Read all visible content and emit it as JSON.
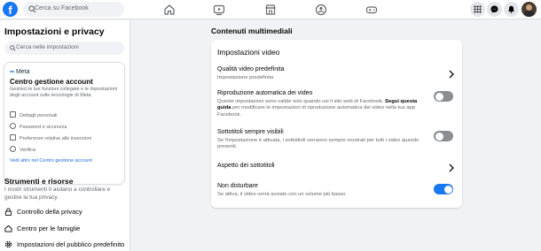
{
  "topbar": {
    "logo_letter": "f",
    "search_placeholder": "Cerca su Facebook",
    "nav_icons": [
      "home-icon",
      "video-icon",
      "marketplace-icon",
      "groups-icon",
      "gaming-icon"
    ],
    "right_icons": [
      "menu-grid-icon",
      "messenger-icon",
      "notifications-icon"
    ]
  },
  "sidebar": {
    "title": "Impostazioni e privacy",
    "search_placeholder": "Cerca nelle impostazioni",
    "account_center": {
      "brand": "Meta",
      "title": "Centro gestione account",
      "description": "Gestisci le tue funzioni collegate e le impostazioni degli account sulle tecnologie di Meta.",
      "items": [
        "Dettagli personali",
        "Password e sicurezza",
        "Preferenze relative alle inserzioni",
        "Verifica"
      ],
      "link": "Vedi altro nel Centro gestione account"
    },
    "tools": {
      "title": "Strumenti e risorse",
      "description": "I nostri strumenti ti aiutano a controllare e gestire la tua privacy.",
      "items": [
        "Controllo della privacy",
        "Centro per le famiglie",
        "Impostazioni del pubblico predefinito"
      ]
    }
  },
  "main": {
    "section_title": "Contenuti multimediali",
    "card_title": "Impostazioni video",
    "rows": [
      {
        "label": "Qualità video predefinita",
        "sub": "Impostazione predefinita",
        "control": "chevron"
      },
      {
        "label": "Riproduzione automatica dei video",
        "sub_pre": "Queste impostazioni sono valide solo quando usi il sito web di Facebook. ",
        "sub_bold": "Segui questa guida",
        "sub_post": " per modificare le impostazioni di riproduzione automatica dei video nella tua app Facebook.",
        "control": "toggle",
        "checked": false
      },
      {
        "label": "Sottotitoli sempre visibili",
        "sub": "Se l'impostazione è attivata, i sottotitoli verranno sempre mostrati per tutti i video quando presenti.",
        "control": "toggle",
        "checked": false
      },
      {
        "label": "Aspetto dei sottotitoli",
        "control": "chevron"
      },
      {
        "label": "Non disturbare",
        "sub": "Se attiva, il video verrà avviato con un volume più basso.",
        "control": "toggle",
        "checked": true
      }
    ]
  },
  "colors": {
    "accent": "#1877f2",
    "toggle_off": "#8a8d91",
    "link": "#216fdb"
  }
}
